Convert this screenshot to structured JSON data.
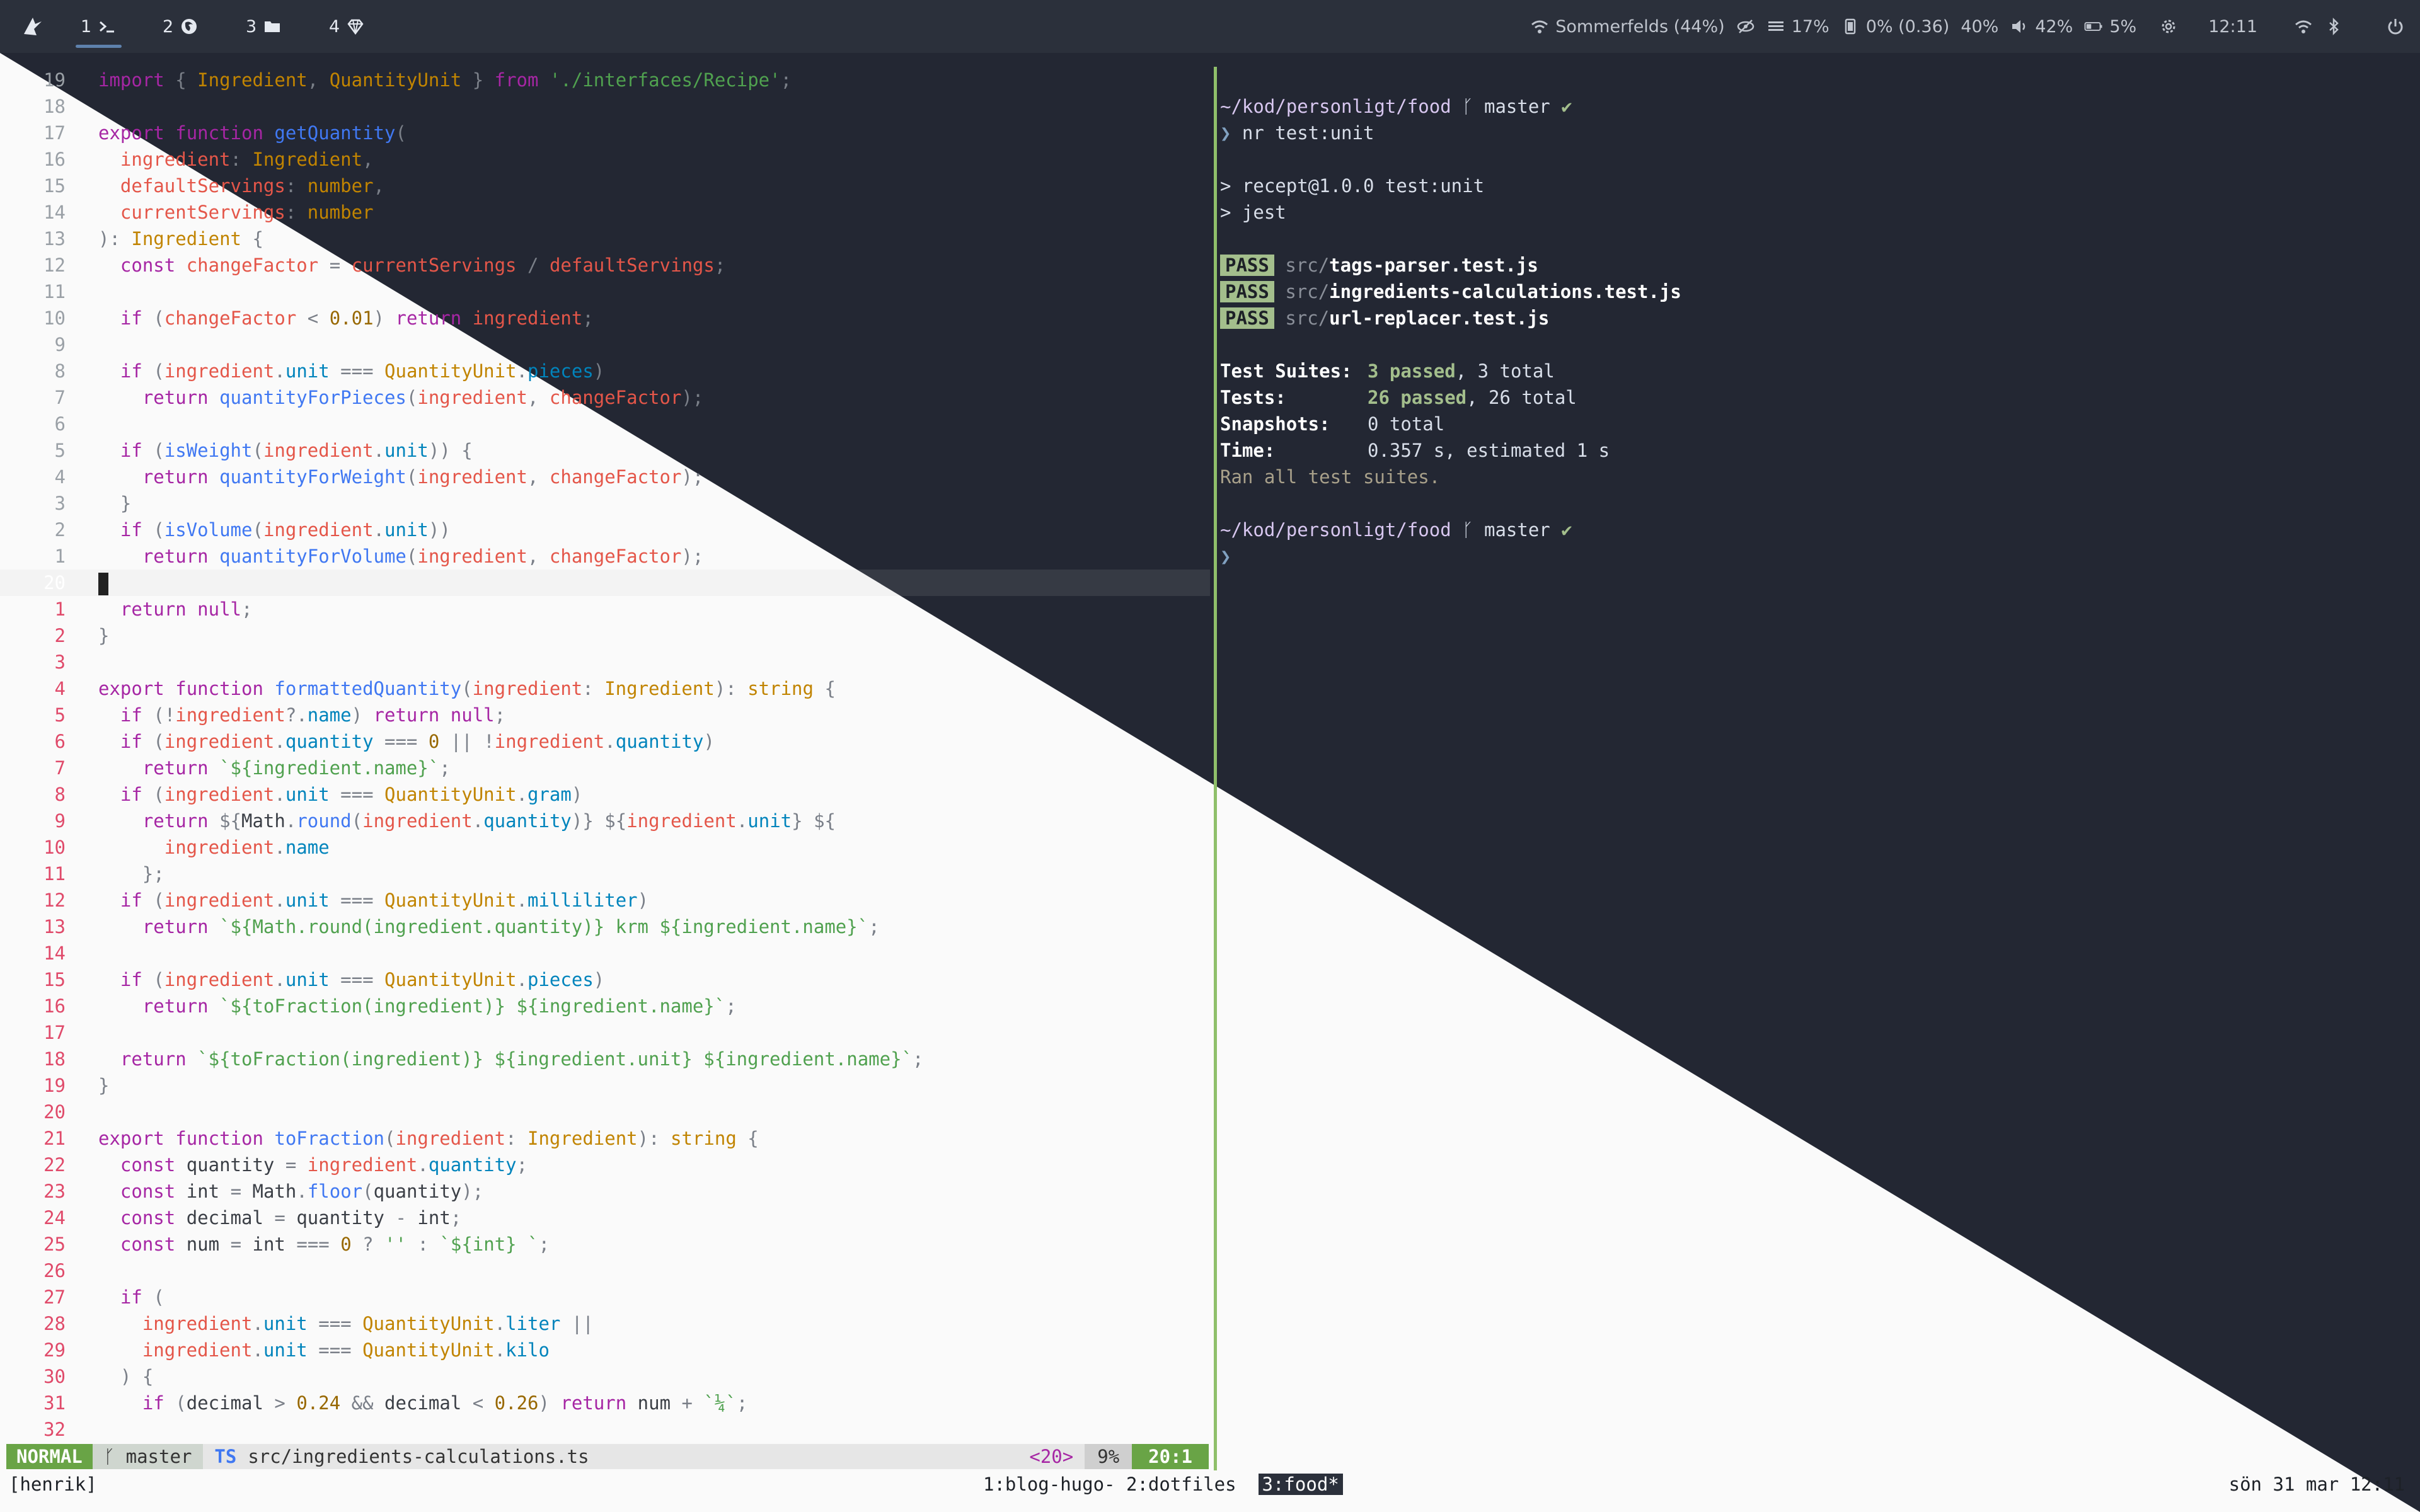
{
  "topbar": {
    "workspaces": [
      {
        "num": "1",
        "icon": "terminal-icon",
        "active": true
      },
      {
        "num": "2",
        "icon": "firefox-icon",
        "active": false
      },
      {
        "num": "3",
        "icon": "folder-icon",
        "active": false
      },
      {
        "num": "4",
        "icon": "gem-icon",
        "active": false
      }
    ],
    "wifi_label": "Sommerfelds (44%)",
    "memory": "17%",
    "cpu": "0% (0.36)",
    "brightness": "40%",
    "volume": "42%",
    "battery": "5%",
    "clock": "12:11"
  },
  "editor": {
    "lines": [
      {
        "n": "19",
        "c": "import { Ingredient, QuantityUnit } from './interfaces/Recipe';"
      },
      {
        "n": "18",
        "c": ""
      },
      {
        "n": "17",
        "c": "export function getQuantity("
      },
      {
        "n": "16",
        "c": "  ingredient: Ingredient,"
      },
      {
        "n": "15",
        "c": "  defaultServings: number,"
      },
      {
        "n": "14",
        "c": "  currentServings: number"
      },
      {
        "n": "13",
        "c": "): Ingredient {"
      },
      {
        "n": "12",
        "c": "  const changeFactor = currentServings / defaultServings;"
      },
      {
        "n": "11",
        "c": ""
      },
      {
        "n": "10",
        "c": "  if (changeFactor < 0.01) return ingredient;"
      },
      {
        "n": "9",
        "c": ""
      },
      {
        "n": "8",
        "c": "  if (ingredient.unit === QuantityUnit.pieces)"
      },
      {
        "n": "7",
        "c": "    return quantityForPieces(ingredient, changeFactor);"
      },
      {
        "n": "6",
        "c": ""
      },
      {
        "n": "5",
        "c": "  if (isWeight(ingredient.unit)) {"
      },
      {
        "n": "4",
        "c": "    return quantityForWeight(ingredient, changeFactor);"
      },
      {
        "n": "3",
        "c": "  }"
      },
      {
        "n": "2",
        "c": "  if (isVolume(ingredient.unit))"
      },
      {
        "n": "1",
        "c": "    return quantityForVolume(ingredient, changeFactor);"
      },
      {
        "n": "20",
        "c": ""
      },
      {
        "n": "1",
        "c": "  return null;"
      },
      {
        "n": "2",
        "c": "}"
      },
      {
        "n": "3",
        "c": ""
      },
      {
        "n": "4",
        "c": "export function formattedQuantity(ingredient: Ingredient): string {"
      },
      {
        "n": "5",
        "c": "  if (!ingredient?.name) return null;"
      },
      {
        "n": "6",
        "c": "  if (ingredient.quantity === 0 || !ingredient.quantity)"
      },
      {
        "n": "7",
        "c": "    return `${ingredient.name}`;"
      },
      {
        "n": "8",
        "c": "  if (ingredient.unit === QuantityUnit.gram)"
      },
      {
        "n": "9",
        "c": "    return `${Math.round(ingredient.quantity)} ${ingredient.unit} ${"
      },
      {
        "n": "10",
        "c": "      ingredient.name"
      },
      {
        "n": "11",
        "c": "    }`;"
      },
      {
        "n": "12",
        "c": "  if (ingredient.unit === QuantityUnit.milliliter)"
      },
      {
        "n": "13",
        "c": "    return `${Math.round(ingredient.quantity)} krm ${ingredient.name}`;"
      },
      {
        "n": "14",
        "c": ""
      },
      {
        "n": "15",
        "c": "  if (ingredient.unit === QuantityUnit.pieces)"
      },
      {
        "n": "16",
        "c": "    return `${toFraction(ingredient)} ${ingredient.name}`;"
      },
      {
        "n": "17",
        "c": ""
      },
      {
        "n": "18",
        "c": "  return `${toFraction(ingredient)} ${ingredient.unit} ${ingredient.name}`;"
      },
      {
        "n": "19",
        "c": "}"
      },
      {
        "n": "20",
        "c": ""
      },
      {
        "n": "21",
        "c": "export function toFraction(ingredient: Ingredient): string {"
      },
      {
        "n": "22",
        "c": "  const quantity = ingredient.quantity;"
      },
      {
        "n": "23",
        "c": "  const int = Math.floor(quantity);"
      },
      {
        "n": "24",
        "c": "  const decimal = quantity - int;"
      },
      {
        "n": "25",
        "c": "  const num = int === 0 ? '' : `${int} `;"
      },
      {
        "n": "26",
        "c": ""
      },
      {
        "n": "27",
        "c": "  if ("
      },
      {
        "n": "28",
        "c": "    ingredient.unit === QuantityUnit.liter ||"
      },
      {
        "n": "29",
        "c": "    ingredient.unit === QuantityUnit.kilo"
      },
      {
        "n": "30",
        "c": "  ) {"
      },
      {
        "n": "31",
        "c": "    if (decimal > 0.24 && decimal < 0.26) return num + `¼`;"
      },
      {
        "n": "32",
        "c": ""
      }
    ],
    "cursor_line_index": 19
  },
  "statusline": {
    "mode": "NORMAL",
    "branch": "master",
    "filetype": "TS",
    "filename": "src/ingredients-calculations.ts",
    "line_marker": "<20>",
    "percent": "9%",
    "position": "20:1"
  },
  "terminal": {
    "cwd": "~/kod/personligt/food",
    "branch": "master",
    "command": "nr test:unit",
    "script_line": "> recept@1.0.0 test:unit",
    "jest_line": "> jest",
    "pass_label": "PASS",
    "results": [
      {
        "dir": "src/",
        "file": "tags-parser.test.js"
      },
      {
        "dir": "src/",
        "file": "ingredients-calculations.test.js"
      },
      {
        "dir": "src/",
        "file": "url-replacer.test.js"
      }
    ],
    "summary": [
      {
        "label": "Test Suites:",
        "passed": "3 passed",
        "rest": ", 3 total"
      },
      {
        "label": "Tests:",
        "passed": "26 passed",
        "rest": ", 26 total"
      },
      {
        "label": "Snapshots:",
        "passed": "",
        "rest": "0 total"
      },
      {
        "label": "Time:",
        "passed": "",
        "rest": "0.357 s, estimated 1 s"
      }
    ],
    "ran_all": "Ran all test suites."
  },
  "tmux": {
    "session": "[henrik]",
    "windows": [
      "1:blog-hugo-",
      "2:dotfiles",
      "3:food*"
    ],
    "datetime": "sön 31 mar 12:11"
  }
}
